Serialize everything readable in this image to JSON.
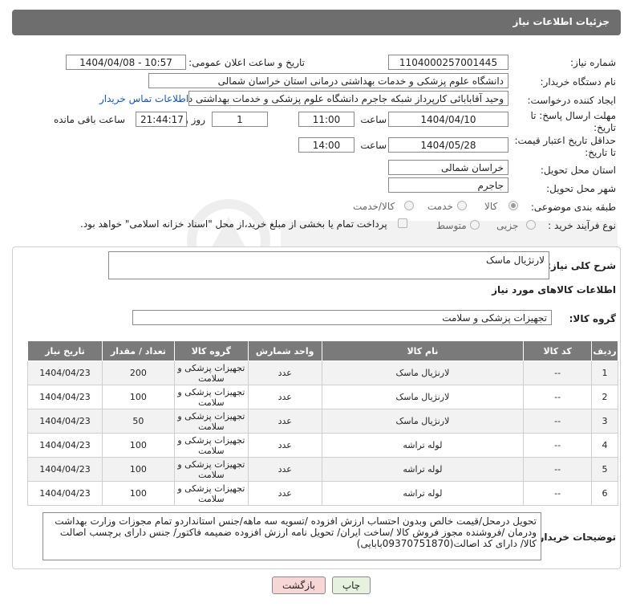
{
  "header": {
    "title": "جزئیات اطلاعات نیاز"
  },
  "form": {
    "need_number_label": "شماره نیاز:",
    "need_number": "1104000257001445",
    "announce_label": "تاریخ و ساعت اعلان عمومی:",
    "announce_value": "1404/04/08 - 10:57",
    "buyer_org_label": "نام دستگاه خریدار:",
    "buyer_org": "دانشگاه علوم پزشکی و خدمات بهداشتی درمانی استان خراسان شمالی",
    "requester_label": "ایجاد کننده درخواست:",
    "requester": "وحید آقابابائی کارپرداز شبکه جاجرم دانشگاه علوم پزشکی و خدمات بهداشتی د",
    "contact_link": "اطلاعات تماس خریدار",
    "reply_deadline_label_1": "مهلت ارسال پاسخ: تا",
    "reply_deadline_label_2": "تاریخ:",
    "reply_date": "1404/04/10",
    "time_label": "ساعت",
    "reply_time": "11:00",
    "days_value": "1",
    "days_label": "روز و",
    "remaining_time": "21:44:17",
    "remaining_label": "ساعت باقی مانده",
    "price_validity_label_1": "حداقل تاریخ اعتبار قیمت:",
    "price_validity_label_2": "تا تاریخ:",
    "price_date": "1404/05/28",
    "price_time": "14:00",
    "province_label": "استان محل تحویل:",
    "province": "خراسان شمالی",
    "city_label": "شهر محل تحویل:",
    "city": "جاجرم",
    "category_label": "طبقه بندی موضوعی:",
    "category_options": [
      "کالا",
      "خدمت",
      "کالا/خدمت"
    ],
    "process_label": "نوع فرآیند خرید :",
    "process_options": [
      "جزیی",
      "متوسط"
    ],
    "payment_note": "پرداخت تمام یا بخشی از مبلغ خرید،از محل \"اسناد خزانه اسلامی\" خواهد بود."
  },
  "details": {
    "general_desc_label": "شرح کلی نیاز:",
    "general_desc": "لارنژیال ماسک",
    "goods_info_title": "اطلاعات کالاهای مورد نیاز",
    "goods_group_label": "گروه کالا:",
    "goods_group": "تجهیزات پزشکی و سلامت"
  },
  "table": {
    "headers": [
      "ردیف",
      "کد کالا",
      "نام کالا",
      "واحد شمارش",
      "گروه کالا",
      "تعداد / مقدار",
      "تاریخ نیاز"
    ],
    "rows": [
      [
        "1",
        "--",
        "لارنژیال ماسک",
        "عدد",
        "تجهیزات پزشکی و سلامت",
        "200",
        "1404/04/23"
      ],
      [
        "2",
        "--",
        "لارنژیال ماسک",
        "عدد",
        "تجهیزات پزشکی و سلامت",
        "100",
        "1404/04/23"
      ],
      [
        "3",
        "--",
        "لارنژیال ماسک",
        "عدد",
        "تجهیزات پزشکی و سلامت",
        "50",
        "1404/04/23"
      ],
      [
        "4",
        "--",
        "لوله تراشه",
        "عدد",
        "تجهیزات پزشکی و سلامت",
        "100",
        "1404/04/23"
      ],
      [
        "5",
        "--",
        "لوله تراشه",
        "عدد",
        "تجهیزات پزشکی و سلامت",
        "100",
        "1404/04/23"
      ],
      [
        "6",
        "--",
        "لوله تراشه",
        "عدد",
        "تجهیزات پزشکی و سلامت",
        "100",
        "1404/04/23"
      ]
    ]
  },
  "buyer_notes": {
    "label": "توضیحات خریدار:",
    "text": "تحویل درمحل/قیمت خالص وبدون احتساب ارزش افزوده /تسویه سه ماهه/جنس استانداردو تمام مجوزات وزارت بهداشت ودرمان /فروشنده مجوز فروش کالا /ساخت ایران/ تحویل  نامه ارزش افزوده ضمیمه  فاکتور/ جنس دارای برچسب اصالت کالا/ دارای کد اصالت(09370751870بابایی)"
  },
  "buttons": {
    "print": "چاپ",
    "back": "بازگشت"
  },
  "colors": {
    "header_bg": "#6e6e6e",
    "link": "#1155cc",
    "back_btn_bg": "#f7d6d6",
    "print_btn_bg": "#e6f2dd"
  }
}
